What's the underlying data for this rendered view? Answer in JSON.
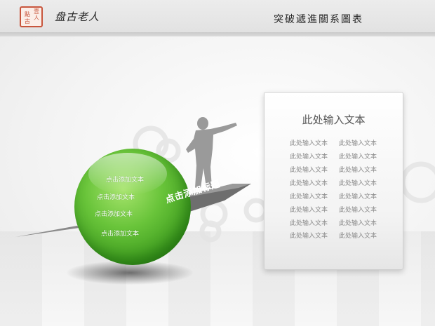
{
  "header": {
    "seal_chars": [
      "壹",
      "人",
      "點",
      "古"
    ],
    "brand": "盘古老人",
    "title": "突破遞進關系圖表"
  },
  "sphere": {
    "items": [
      "点击添加文本",
      "点击添加文本",
      "点击添加文本",
      "点击添加文本"
    ]
  },
  "arrow": {
    "label": "点击添加标题"
  },
  "panel": {
    "title": "此处输入文本",
    "left_column": [
      "此处输入文本",
      "此处输入文本",
      "此处输入文本",
      "此处输入文本",
      "此处输入文本",
      "此处输入文本",
      "此处输入文本",
      "此处输入文本"
    ],
    "right_column": [
      "此处输入文本",
      "此处输入文本",
      "此处输入文本",
      "此处输入文本",
      "此处输入文本",
      "此处输入文本",
      "此处输入文本",
      "此处输入文本"
    ]
  },
  "colors": {
    "sphere_green": "#4cae2a",
    "arrow_gray": "#6e6e6e",
    "seal_red": "#c8553c"
  }
}
